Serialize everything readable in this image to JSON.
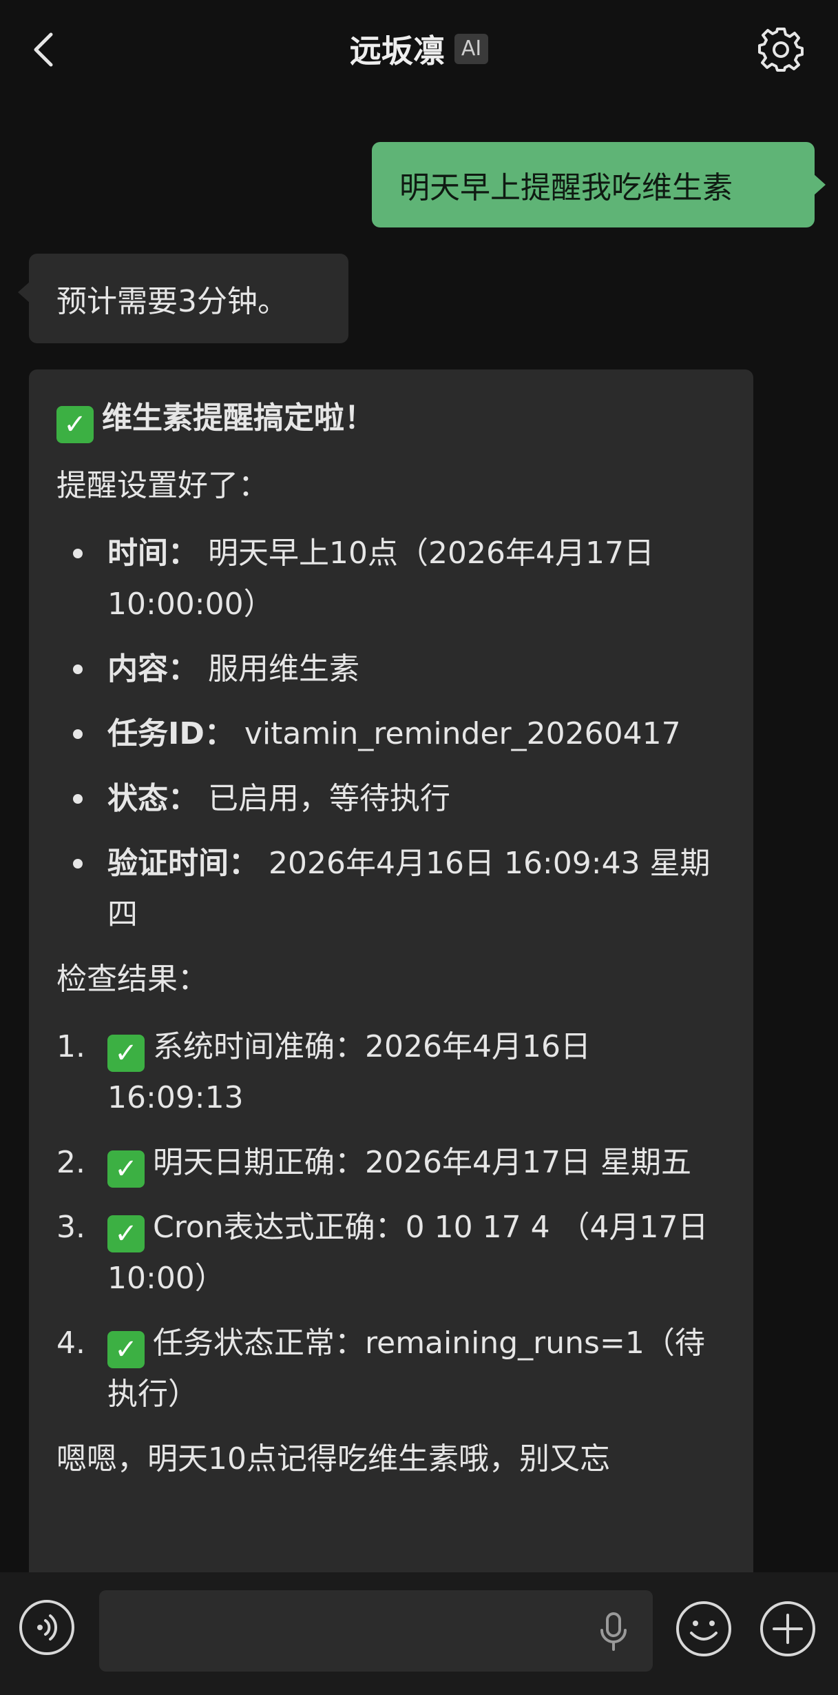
{
  "header": {
    "title": "远坂凛",
    "badge": "AI",
    "back_icon": "chevron-left-icon",
    "settings_icon": "gear-icon"
  },
  "messages": {
    "user_1": "明天早上提醒我吃维生素",
    "ai_1": "预计需要3分钟。",
    "ai_2": {
      "heading": "维生素提醒搞定啦！",
      "setup_title": "提醒设置好了：",
      "details": [
        {
          "key": "时间：",
          "value": "明天早上10点（2026年4月17日 10:00:00）"
        },
        {
          "key": "内容：",
          "value": "服用维生素"
        },
        {
          "key": "任务ID：",
          "value": "vitamin_reminder_20260417"
        },
        {
          "key": "状态：",
          "value": "已启用，等待执行"
        },
        {
          "key": "验证时间：",
          "value": "2026年4月16日 16:09:43 星期四"
        }
      ],
      "check_title": "检查结果：",
      "checks": [
        {
          "num": "1.",
          "text": "系统时间准确：2026年4月16日 16:09:13"
        },
        {
          "num": "2.",
          "text": "明天日期正确：2026年4月17日 星期五"
        },
        {
          "num": "3.",
          "text": "Cron表达式正确：0 10 17 4 （4月17日10:00）"
        },
        {
          "num": "4.",
          "text": "任务状态正常：remaining_runs=1（待执行）"
        }
      ],
      "footer_partial": "嗯嗯，明天10点记得吃维生素哦，别又忘"
    }
  },
  "composer": {
    "input_value": "",
    "voice_icon": "voice-wave-icon",
    "mic_icon": "microphone-icon",
    "emoji_icon": "smile-icon",
    "plus_icon": "plus-icon"
  },
  "colors": {
    "background": "#111111",
    "user_bubble": "#5fb476",
    "ai_bubble": "#2b2b2b",
    "check_green": "#3cb043"
  }
}
